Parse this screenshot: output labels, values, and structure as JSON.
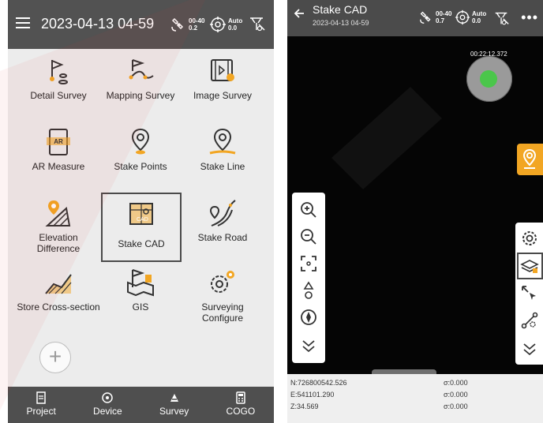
{
  "left_screen": {
    "header": {
      "datetime": "2023-04-13 04-59",
      "sat_top": "00-40",
      "sat_bottom": "0.2",
      "mode_top": "Auto",
      "mode_bottom": "0.0"
    },
    "apps": [
      {
        "label": "Detail Survey"
      },
      {
        "label": "Mapping Survey"
      },
      {
        "label": "Image Survey"
      },
      {
        "label": "AR Measure"
      },
      {
        "label": "Stake Points"
      },
      {
        "label": "Stake Line"
      },
      {
        "label": "Elevation Difference"
      },
      {
        "label": "Stake CAD"
      },
      {
        "label": "Stake Road"
      },
      {
        "label": "Store Cross-section"
      },
      {
        "label": "GIS"
      },
      {
        "label": "Surveying Configure"
      }
    ],
    "add_label": "+",
    "bottom_nav": [
      {
        "label": "Project"
      },
      {
        "label": "Device"
      },
      {
        "label": "Survey"
      },
      {
        "label": "COGO"
      }
    ]
  },
  "right_screen": {
    "header": {
      "title": "Stake CAD",
      "date": "2023-04-13 04-59",
      "sat_top": "00-40",
      "sat_bottom": "0.7",
      "mode_top": "Auto",
      "mode_bottom": "0.0"
    },
    "timer": "00:22:12.372",
    "coordinates": {
      "n": "N:726800542.526",
      "e": "E:541101.290",
      "z": "Z:34.569",
      "sigma_n": "σ:0.000",
      "sigma_e": "σ:0.000",
      "sigma_z": "σ:0.000"
    }
  },
  "colors": {
    "accent_orange": "#f2a623",
    "accent_green": "#4bc64b",
    "header": "#525252"
  }
}
